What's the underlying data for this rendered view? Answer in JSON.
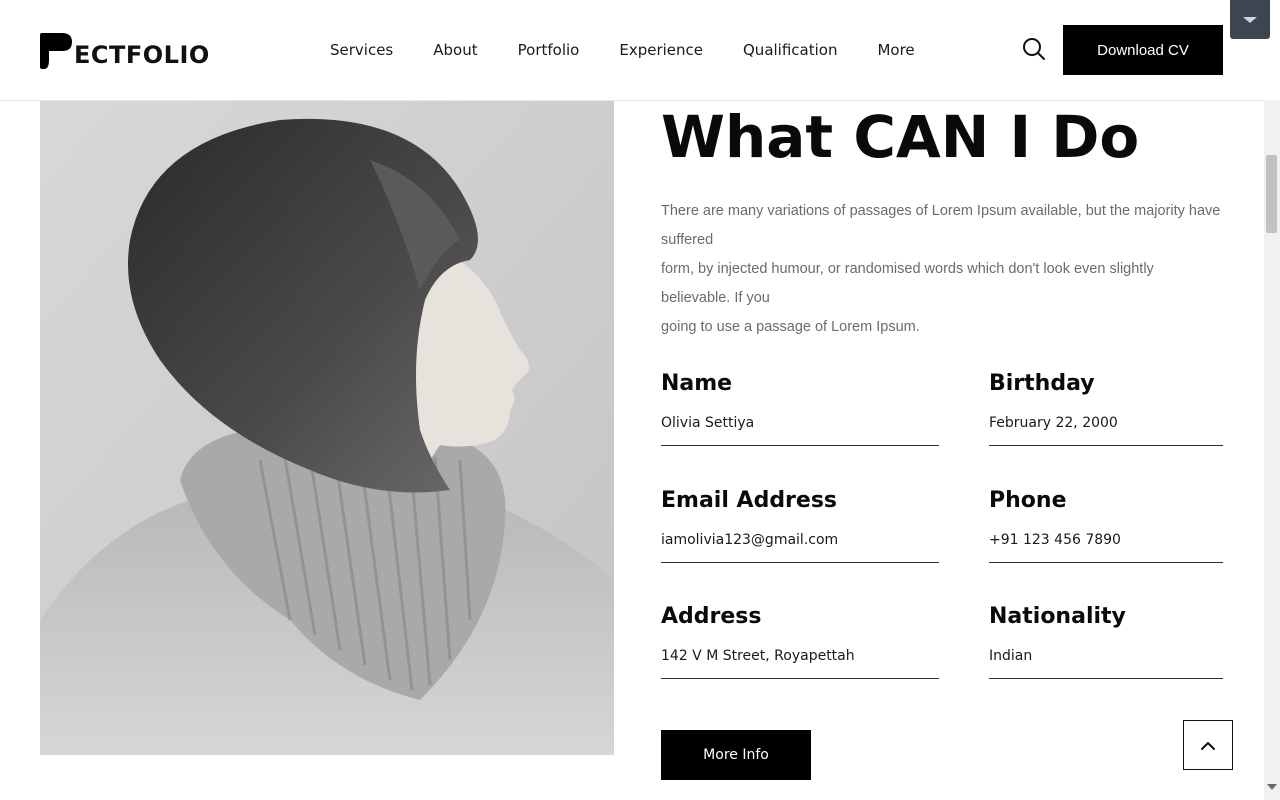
{
  "header": {
    "logo_text": "ECTFOLIO",
    "nav": [
      "Services",
      "About",
      "Portfolio",
      "Experience",
      "Qualification",
      "More"
    ],
    "download_cv_label": "Download CV"
  },
  "main": {
    "title": "What CAN I Do",
    "description": [
      "There are many variations of passages of Lorem Ipsum available, but the majority have suffered",
      "form, by injected humour, or randomised words which don't look even slightly believable. If you",
      "going to use a passage of Lorem Ipsum."
    ],
    "fields": [
      {
        "label": "Name",
        "value": "Olivia Settiya"
      },
      {
        "label": "Birthday",
        "value": "February 22, 2000"
      },
      {
        "label": "Email Address",
        "value": "iamolivia123@gmail.com"
      },
      {
        "label": "Phone",
        "value": "+91 123 456 7890"
      },
      {
        "label": "Address",
        "value": "142 V M Street, Royapettah"
      },
      {
        "label": "Nationality",
        "value": "Indian"
      }
    ],
    "more_info_label": "More Info"
  },
  "icons": {
    "search": "search-icon",
    "back_to_top": "chevron-up-icon",
    "toggle": "caret-down-icon"
  }
}
